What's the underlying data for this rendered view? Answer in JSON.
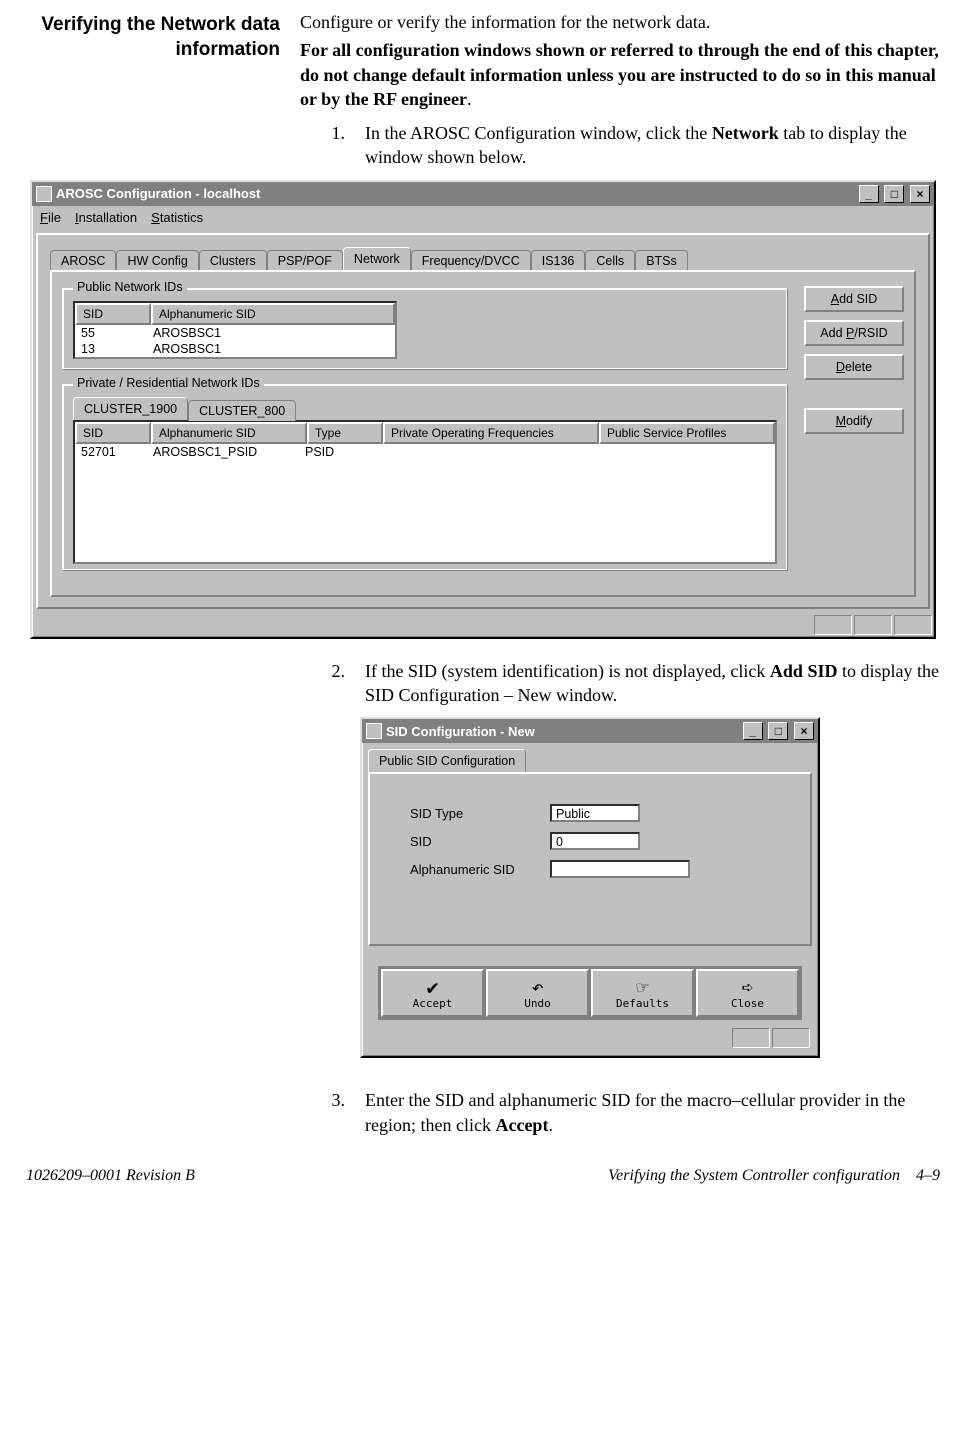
{
  "heading": "Verifying the Network data information",
  "intro_plain": "Configure or verify the information for the network data.",
  "intro_bold": "For all configuration windows shown or referred to through the end of this chapter, do not change default information unless you are instructed to do so in this manual or by the RF engineer",
  "steps": {
    "s1_num": "1.",
    "s1_pre": "In the AROSC Configuration window, click the ",
    "s1_bold": "Network",
    "s1_post": " tab to display the window shown below.",
    "s2_num": "2.",
    "s2_pre": "If the SID (system identification) is not displayed, click ",
    "s2_bold": "Add SID",
    "s2_post": " to display the SID Configuration – New window.",
    "s3_num": "3.",
    "s3_pre": "Enter the SID and alphanumeric SID for the macro–cellular provider in the region; then click ",
    "s3_bold": "Accept",
    "s3_post": "."
  },
  "window1": {
    "title": "AROSC Configuration - localhost",
    "menu": {
      "file": "File",
      "installation": "Installation",
      "statistics": "Statistics",
      "file_u": "F",
      "inst_u": "I",
      "stat_u": "S",
      "file_rest": "ile",
      "inst_rest": "nstallation",
      "stat_rest": "tatistics"
    },
    "tabs": [
      "AROSC",
      "HW Config",
      "Clusters",
      "PSP/POF",
      "Network",
      "Frequency/DVCC",
      "IS136",
      "Cells",
      "BTSs"
    ],
    "active_tab_index": 4,
    "public_group": "Public Network IDs",
    "public_cols": {
      "sid": "SID",
      "alpha": "Alphanumeric SID"
    },
    "public_rows": [
      {
        "sid": "55",
        "alpha": "AROSBSC1"
      },
      {
        "sid": "13",
        "alpha": "AROSBSC1"
      }
    ],
    "private_group": "Private / Residential Network IDs",
    "private_tabs": [
      "CLUSTER_1900",
      "CLUSTER_800"
    ],
    "private_active_tab": 0,
    "private_cols": {
      "sid": "SID",
      "alpha": "Alphanumeric SID",
      "type": "Type",
      "freq": "Private Operating Frequencies",
      "profiles": "Public Service Profiles"
    },
    "private_rows": [
      {
        "sid": "52701",
        "alpha": "AROSBSC1_PSID",
        "type": "PSID",
        "freq": "",
        "profiles": ""
      }
    ],
    "buttons": {
      "add_sid_u": "A",
      "add_sid_rest": "dd SID",
      "add_prsid_pre": "Add ",
      "add_prsid_u": "P",
      "add_prsid_rest": "/RSID",
      "delete_u": "D",
      "delete_rest": "elete",
      "modify_u": "M",
      "modify_rest": "odify"
    }
  },
  "window2": {
    "title": "SID Configuration - New",
    "tab": "Public SID Configuration",
    "fields": {
      "sid_type_label": "SID Type",
      "sid_type_value": "Public",
      "sid_label": "SID",
      "sid_value": "0",
      "alpha_label": "Alphanumeric SID",
      "alpha_value": ""
    },
    "toolbar": {
      "accept": "Accept",
      "undo": "Undo",
      "defaults": "Defaults",
      "close": "Close"
    }
  },
  "footer": {
    "left": "1026209–0001  Revision B",
    "right_text": "Verifying the System Controller configuration",
    "right_page": "4–9"
  }
}
